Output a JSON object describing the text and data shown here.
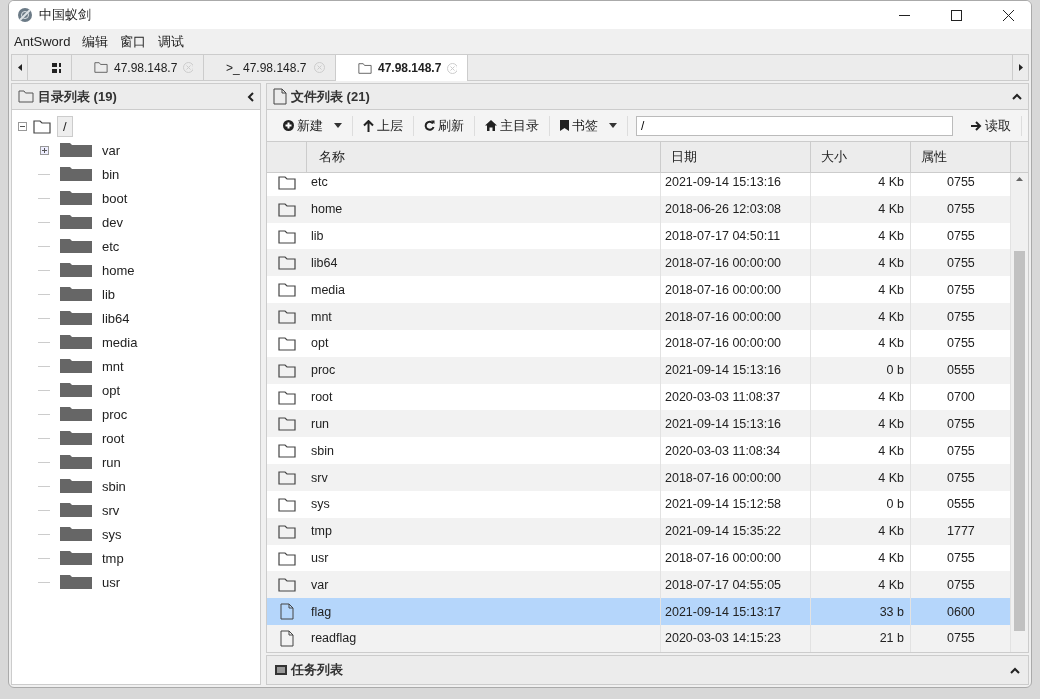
{
  "window": {
    "title": "中国蚁剑"
  },
  "menu": [
    "AntSword",
    "编辑",
    "窗口",
    "调试"
  ],
  "tabs": [
    {
      "kind": "home",
      "selected": false
    },
    {
      "kind": "folder",
      "label": "47.98.148.7",
      "selected": false
    },
    {
      "kind": "terminal",
      "label": ">_ 47.98.148.7",
      "selected": false
    },
    {
      "kind": "folder",
      "label": "47.98.148.7",
      "selected": true
    }
  ],
  "dir_panel": {
    "title": "目录列表 (19)",
    "root": {
      "label": "/",
      "expanded": true,
      "children": [
        {
          "label": "var",
          "expandable": true
        },
        {
          "label": "bin",
          "expandable": false
        },
        {
          "label": "boot",
          "expandable": false
        },
        {
          "label": "dev",
          "expandable": false
        },
        {
          "label": "etc",
          "expandable": false
        },
        {
          "label": "home",
          "expandable": false
        },
        {
          "label": "lib",
          "expandable": false
        },
        {
          "label": "lib64",
          "expandable": false
        },
        {
          "label": "media",
          "expandable": false
        },
        {
          "label": "mnt",
          "expandable": false
        },
        {
          "label": "opt",
          "expandable": false
        },
        {
          "label": "proc",
          "expandable": false
        },
        {
          "label": "root",
          "expandable": false
        },
        {
          "label": "run",
          "expandable": false
        },
        {
          "label": "sbin",
          "expandable": false
        },
        {
          "label": "srv",
          "expandable": false
        },
        {
          "label": "sys",
          "expandable": false
        },
        {
          "label": "tmp",
          "expandable": false
        },
        {
          "label": "usr",
          "expandable": false
        }
      ]
    }
  },
  "file_panel": {
    "title": "文件列表 (21)",
    "toolbar": [
      {
        "kind": "new",
        "label": "新建",
        "dropdown": true
      },
      {
        "kind": "up",
        "label": "上层",
        "dropdown": false
      },
      {
        "kind": "refresh",
        "label": "刷新",
        "dropdown": false
      },
      {
        "kind": "home",
        "label": "主目录",
        "dropdown": false
      },
      {
        "kind": "bookmark",
        "label": "书签",
        "dropdown": true
      }
    ],
    "path": "/",
    "read_button": "读取",
    "columns": [
      "名称",
      "日期",
      "大小",
      "属性"
    ],
    "rows": [
      {
        "kind": "folder",
        "name": "etc",
        "date": "2021-09-14 15:13:16",
        "size": "4 Kb",
        "perm": "0755",
        "selected": false
      },
      {
        "kind": "folder",
        "name": "home",
        "date": "2018-06-26 12:03:08",
        "size": "4 Kb",
        "perm": "0755",
        "selected": false
      },
      {
        "kind": "folder",
        "name": "lib",
        "date": "2018-07-17 04:50:11",
        "size": "4 Kb",
        "perm": "0755",
        "selected": false
      },
      {
        "kind": "folder",
        "name": "lib64",
        "date": "2018-07-16 00:00:00",
        "size": "4 Kb",
        "perm": "0755",
        "selected": false
      },
      {
        "kind": "folder",
        "name": "media",
        "date": "2018-07-16 00:00:00",
        "size": "4 Kb",
        "perm": "0755",
        "selected": false
      },
      {
        "kind": "folder",
        "name": "mnt",
        "date": "2018-07-16 00:00:00",
        "size": "4 Kb",
        "perm": "0755",
        "selected": false
      },
      {
        "kind": "folder",
        "name": "opt",
        "date": "2018-07-16 00:00:00",
        "size": "4 Kb",
        "perm": "0755",
        "selected": false
      },
      {
        "kind": "folder",
        "name": "proc",
        "date": "2021-09-14 15:13:16",
        "size": "0 b",
        "perm": "0555",
        "selected": false
      },
      {
        "kind": "folder",
        "name": "root",
        "date": "2020-03-03 11:08:37",
        "size": "4 Kb",
        "perm": "0700",
        "selected": false
      },
      {
        "kind": "folder",
        "name": "run",
        "date": "2021-09-14 15:13:16",
        "size": "4 Kb",
        "perm": "0755",
        "selected": false
      },
      {
        "kind": "folder",
        "name": "sbin",
        "date": "2020-03-03 11:08:34",
        "size": "4 Kb",
        "perm": "0755",
        "selected": false
      },
      {
        "kind": "folder",
        "name": "srv",
        "date": "2018-07-16 00:00:00",
        "size": "4 Kb",
        "perm": "0755",
        "selected": false
      },
      {
        "kind": "folder",
        "name": "sys",
        "date": "2021-09-14 15:12:58",
        "size": "0 b",
        "perm": "0555",
        "selected": false
      },
      {
        "kind": "folder",
        "name": "tmp",
        "date": "2021-09-14 15:35:22",
        "size": "4 Kb",
        "perm": "1777",
        "selected": false
      },
      {
        "kind": "folder",
        "name": "usr",
        "date": "2018-07-16 00:00:00",
        "size": "4 Kb",
        "perm": "0755",
        "selected": false
      },
      {
        "kind": "folder",
        "name": "var",
        "date": "2018-07-17 04:55:05",
        "size": "4 Kb",
        "perm": "0755",
        "selected": false
      },
      {
        "kind": "file",
        "name": "flag",
        "date": "2021-09-14 15:13:17",
        "size": "33 b",
        "perm": "0600",
        "selected": true
      },
      {
        "kind": "file",
        "name": "readflag",
        "date": "2020-03-03 14:15:23",
        "size": "21 b",
        "perm": "0755",
        "selected": false
      }
    ]
  },
  "task_panel": {
    "title": "任务列表"
  }
}
